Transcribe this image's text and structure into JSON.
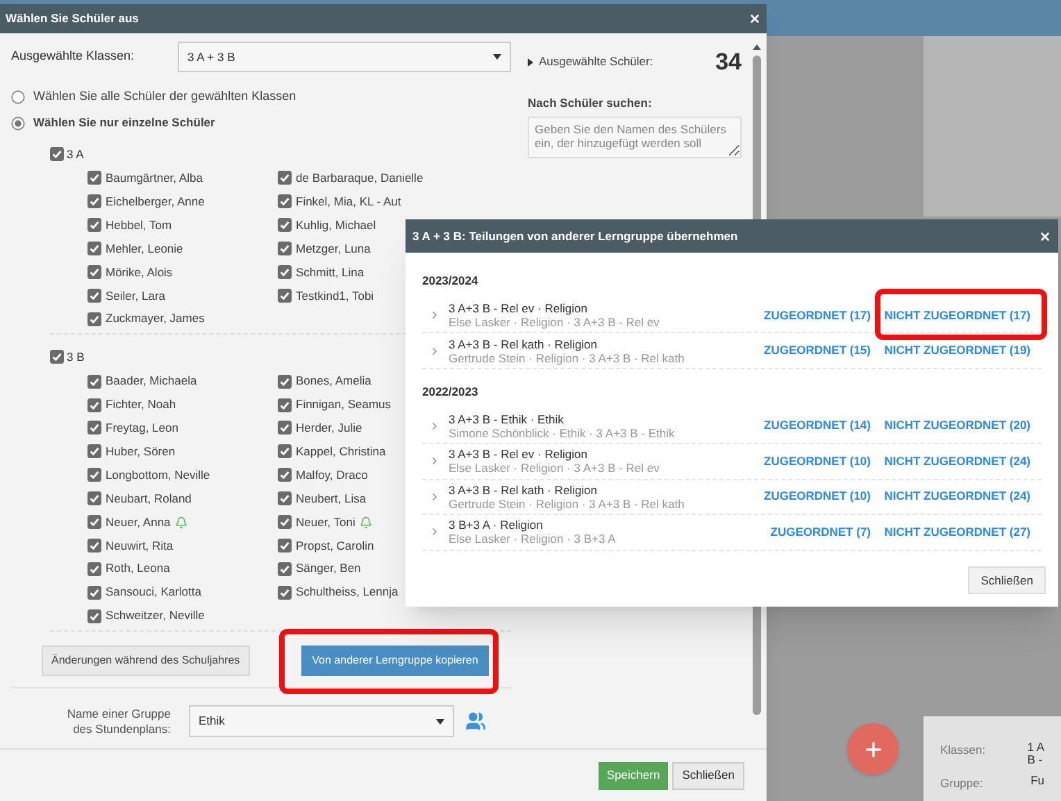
{
  "dialog": {
    "title": "Wählen Sie Schüler aus",
    "classes_label": "Ausgewählte Klassen:",
    "classes_value": "3 A + 3 B",
    "options": [
      {
        "label": "Wählen Sie alle Schüler der gewählten Klassen",
        "selected": false
      },
      {
        "label": "Wählen Sie nur einzelne Schüler",
        "selected": true
      }
    ],
    "groups": [
      {
        "name": "3 A",
        "checked": true,
        "students": [
          {
            "name": "Baumgärtner, Alba",
            "checked": true,
            "alert": false
          },
          {
            "name": "de Barbaraque, Danielle",
            "checked": true,
            "alert": false
          },
          {
            "name": "Eichelberger, Anne",
            "checked": true,
            "alert": false
          },
          {
            "name": "Finkel, Mia, KL - Aut",
            "checked": true,
            "alert": false
          },
          {
            "name": "Hebbel, Tom",
            "checked": true,
            "alert": false
          },
          {
            "name": "Kuhlig, Michael",
            "checked": true,
            "alert": false
          },
          {
            "name": "Mehler, Leonie",
            "checked": true,
            "alert": false
          },
          {
            "name": "Metzger, Luna",
            "checked": true,
            "alert": false
          },
          {
            "name": "Mörike, Alois",
            "checked": true,
            "alert": false
          },
          {
            "name": "Schmitt, Lina",
            "checked": true,
            "alert": false
          },
          {
            "name": "Seiler, Lara",
            "checked": true,
            "alert": false
          },
          {
            "name": "Testkind1, Tobi",
            "checked": true,
            "alert": false
          },
          {
            "name": "Zuckmayer, James",
            "checked": true,
            "alert": false
          }
        ]
      },
      {
        "name": "3 B",
        "checked": true,
        "students": [
          {
            "name": "Baader, Michaela",
            "checked": true,
            "alert": false
          },
          {
            "name": "Bones, Amelia",
            "checked": true,
            "alert": false
          },
          {
            "name": "Fichter, Noah",
            "checked": true,
            "alert": false
          },
          {
            "name": "Finnigan, Seamus",
            "checked": true,
            "alert": false
          },
          {
            "name": "Freytag, Leon",
            "checked": true,
            "alert": false
          },
          {
            "name": "Herder, Julie",
            "checked": true,
            "alert": false
          },
          {
            "name": "Huber, Sören",
            "checked": true,
            "alert": false
          },
          {
            "name": "Kappel, Christina",
            "checked": true,
            "alert": false
          },
          {
            "name": "Longbottom, Neville",
            "checked": true,
            "alert": false
          },
          {
            "name": "Malfoy, Draco",
            "checked": true,
            "alert": false
          },
          {
            "name": "Neubart, Roland",
            "checked": true,
            "alert": false
          },
          {
            "name": "Neubert, Lisa",
            "checked": true,
            "alert": false
          },
          {
            "name": "Neuer, Anna",
            "checked": true,
            "alert": true
          },
          {
            "name": "Neuer, Toni",
            "checked": true,
            "alert": true
          },
          {
            "name": "Neuwirt, Rita",
            "checked": true,
            "alert": false
          },
          {
            "name": "Propst, Carolin",
            "checked": true,
            "alert": false
          },
          {
            "name": "Roth, Leona",
            "checked": true,
            "alert": false
          },
          {
            "name": "Sänger, Ben",
            "checked": true,
            "alert": false
          },
          {
            "name": "Sansouci, Karlotta",
            "checked": true,
            "alert": false
          },
          {
            "name": "Schultheiss, Lennja",
            "checked": true,
            "alert": false
          },
          {
            "name": "Schweitzer, Neville",
            "checked": true,
            "alert": false
          }
        ]
      }
    ],
    "changes_button": "Änderungen während des Schuljahres",
    "copy_button": {
      "label": "Von anderer Lerngruppe kopieren",
      "highlighted": true
    },
    "group_name_label": "Name einer Gruppe des Stundenplans:",
    "group_name_value": "Ethik",
    "selected_label": "Ausgewählte Schüler:",
    "selected_count": "34",
    "search_label": "Nach Schüler suchen:",
    "search_placeholder": "Geben Sie den Namen des Schülers ein, der hinzugefügt werden soll",
    "buttons": [
      "Speichern",
      "Schließen"
    ]
  },
  "copy_dialog": {
    "title": "3 A + 3 B: Teilungen von anderer Lerngruppe übernehmen",
    "sections": [
      {
        "year": "2023/2024",
        "items": [
          {
            "title": "3 A+3 B - Rel ev · Religion",
            "detail": "Else Lasker · Religion · 3 A+3 B - Rel ev",
            "assigned": "ZUGEORDNET (17)",
            "unassigned": "NICHT ZUGEORDNET (17)",
            "highlighted": true
          },
          {
            "title": "3 A+3 B - Rel kath · Religion",
            "detail": "Gertrude Stein · Religion · 3 A+3 B - Rel kath",
            "assigned": "ZUGEORDNET (15)",
            "unassigned": "NICHT ZUGEORDNET (19)",
            "highlighted": false
          }
        ]
      },
      {
        "year": "2022/2023",
        "items": [
          {
            "title": "3 A+3 B - Ethik · Ethik",
            "detail": "Simone Schönblick · Ethik · 3 A+3 B - Ethik",
            "assigned": "ZUGEORDNET (14)",
            "unassigned": "NICHT ZUGEORDNET (20)",
            "highlighted": false
          },
          {
            "title": "3 A+3 B - Rel ev · Religion",
            "detail": "Else Lasker · Religion · 3 A+3 B - Rel ev",
            "assigned": "ZUGEORDNET (10)",
            "unassigned": "NICHT ZUGEORDNET (24)",
            "highlighted": false
          },
          {
            "title": "3 A+3 B - Rel kath · Religion",
            "detail": "Gertrude Stein · Religion · 3 A+3 B - Rel kath",
            "assigned": "ZUGEORDNET (10)",
            "unassigned": "NICHT ZUGEORDNET (24)",
            "highlighted": false
          },
          {
            "title": "3 B+3 A · Religion",
            "detail": "Else Lasker · Religion · 3 B+3 A",
            "assigned": "ZUGEORDNET (7)",
            "unassigned": "NICHT ZUGEORDNET (27)",
            "highlighted": false
          }
        ]
      }
    ],
    "close_button": "Schließen"
  },
  "background_panel": {
    "rows": [
      {
        "label": "Klassen:",
        "value": "1 A\nB -"
      },
      {
        "label": "Gruppe:",
        "value": "Fu"
      }
    ]
  }
}
